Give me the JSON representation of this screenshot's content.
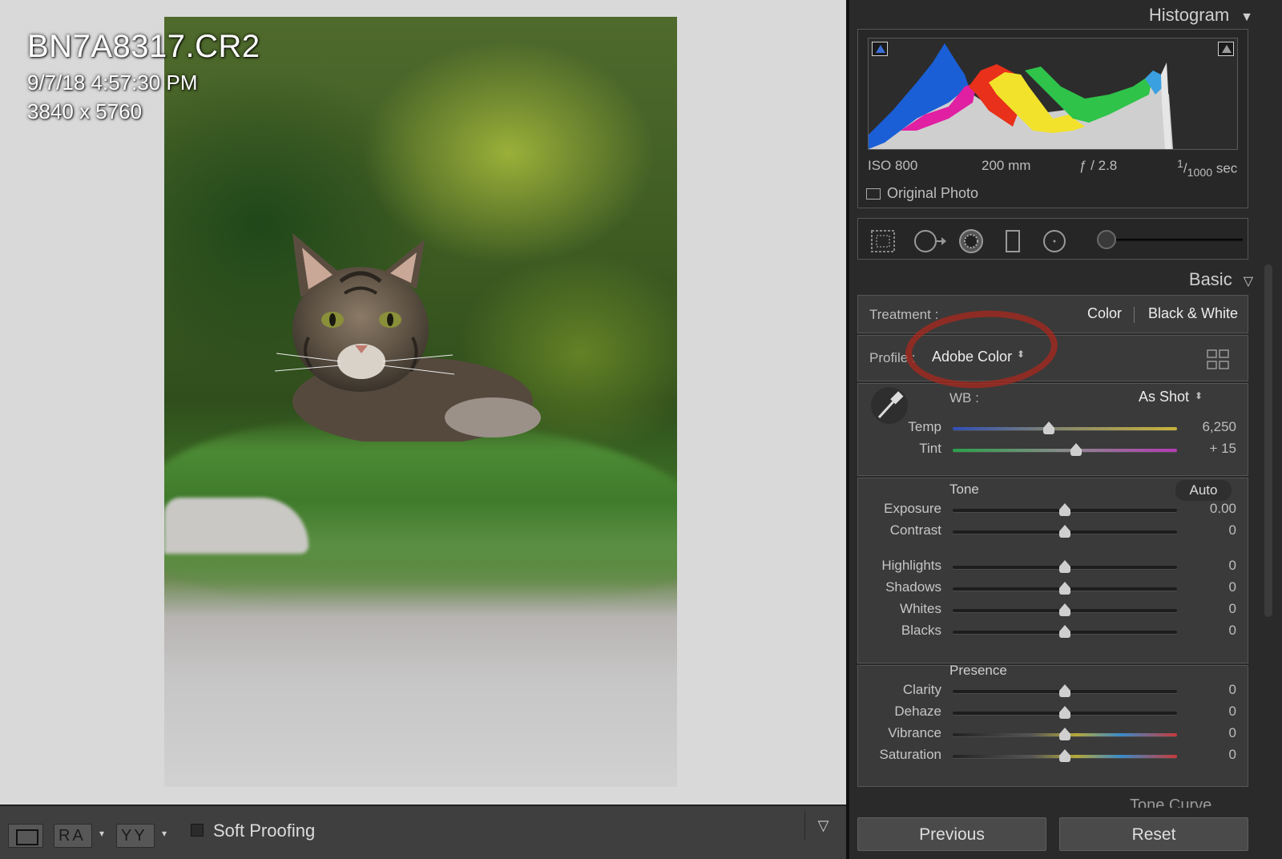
{
  "photo": {
    "filename": "BN7A8317.CR2",
    "datetime": "9/7/18 4:57:30 PM",
    "dimensions": "3840 x 5760"
  },
  "toolbar": {
    "soft_proofing_label": "Soft Proofing",
    "ra_glyph": "RA",
    "yy_glyph": "YY",
    "caret": "▾",
    "menu_caret": "▽"
  },
  "histogram": {
    "title": "Histogram",
    "title_icon": "▼",
    "iso": "ISO 800",
    "focal": "200 mm",
    "aperture": "ƒ / 2.8",
    "shutter_num": "1",
    "shutter_den": "1000",
    "shutter_unit": "sec",
    "original_photo_label": "Original Photo"
  },
  "basic": {
    "title": "Basic",
    "title_icon": "▽",
    "treatment_label": "Treatment :",
    "treatment_color": "Color",
    "treatment_bw": "Black & White",
    "profile_label": "Profile :",
    "profile_value": "Adobe Color",
    "wb_label": "WB :",
    "wb_value": "As Shot",
    "sliders_wb": [
      {
        "label": "Temp",
        "value": "6,250",
        "position": 0.43
      },
      {
        "label": "Tint",
        "value": "+ 15",
        "position": 0.55
      }
    ],
    "tone_label": "Tone",
    "auto_label": "Auto",
    "sliders_tone": [
      {
        "label": "Exposure",
        "value": "0.00",
        "position": 0.5
      },
      {
        "label": "Contrast",
        "value": "0",
        "position": 0.5
      },
      {
        "label": "Highlights",
        "value": "0",
        "position": 0.5
      },
      {
        "label": "Shadows",
        "value": "0",
        "position": 0.5
      },
      {
        "label": "Whites",
        "value": "0",
        "position": 0.5
      },
      {
        "label": "Blacks",
        "value": "0",
        "position": 0.5
      }
    ],
    "presence_label": "Presence",
    "sliders_presence": [
      {
        "label": "Clarity",
        "value": "0",
        "position": 0.5
      },
      {
        "label": "Dehaze",
        "value": "0",
        "position": 0.5
      },
      {
        "label": "Vibrance",
        "value": "0",
        "position": 0.5
      },
      {
        "label": "Saturation",
        "value": "0",
        "position": 0.5
      }
    ]
  },
  "tone_curve_label": "Tone Curve",
  "buttons": {
    "previous": "Previous",
    "reset": "Reset"
  },
  "colors": {
    "highlight_ring": "#aa281e",
    "histogram_blue": "#1a5fd6",
    "histogram_yellow": "#f2e22c",
    "histogram_green": "#2fc34a",
    "histogram_red": "#e8301a",
    "histogram_magenta": "#e01fa3"
  }
}
